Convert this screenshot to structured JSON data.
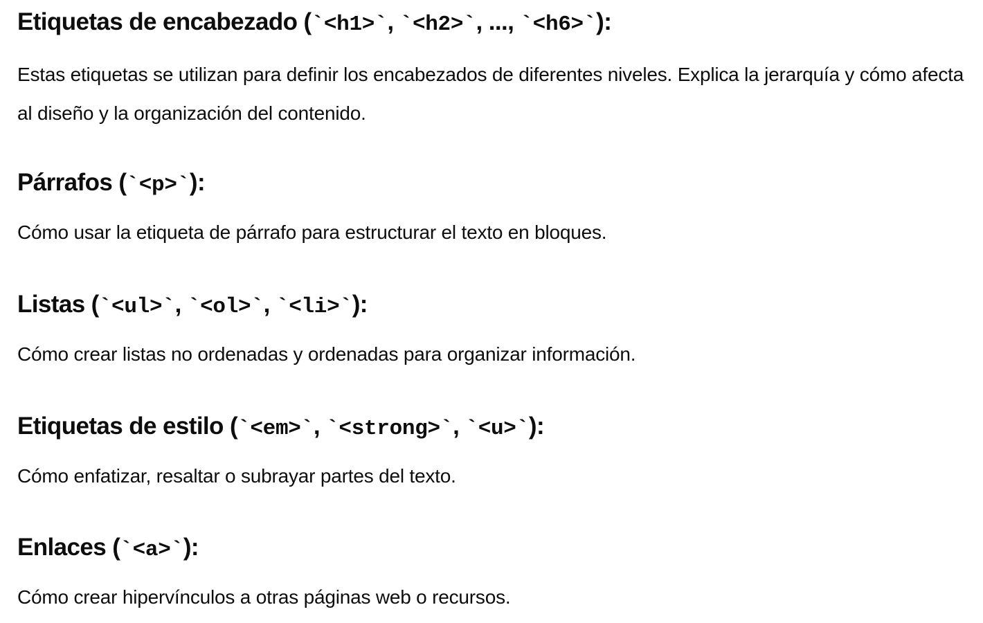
{
  "sections": [
    {
      "heading_prefix": "Etiquetas de encabezado (",
      "heading_parts": [
        "`<h1>`",
        ", ",
        "`<h2>`",
        ", ..., ",
        "`<h6>`"
      ],
      "heading_suffix": "):",
      "body": "Estas etiquetas se utilizan para definir los encabezados de diferentes niveles. Explica la jerarquía y cómo afecta al diseño y la organización del contenido."
    },
    {
      "heading_prefix": "Párrafos (",
      "heading_parts": [
        "`<p>`"
      ],
      "heading_suffix": "):",
      "body": "Cómo usar la etiqueta de párrafo para estructurar el texto en bloques."
    },
    {
      "heading_prefix": "Listas (",
      "heading_parts": [
        "`<ul>`",
        ", ",
        "`<ol>`",
        ", ",
        "`<li>`"
      ],
      "heading_suffix": "):",
      "body": "Cómo crear listas no ordenadas y ordenadas para organizar información."
    },
    {
      "heading_prefix": "Etiquetas de estilo (",
      "heading_parts": [
        "`<em>`",
        ", ",
        "`<strong>`",
        ", ",
        "`<u>`"
      ],
      "heading_suffix": "):",
      "body": "Cómo enfatizar, resaltar o subrayar partes del texto."
    },
    {
      "heading_prefix": "Enlaces (",
      "heading_parts": [
        "`<a>`"
      ],
      "heading_suffix": "):",
      "body": "Cómo crear hipervínculos a otras páginas web o recursos."
    }
  ]
}
